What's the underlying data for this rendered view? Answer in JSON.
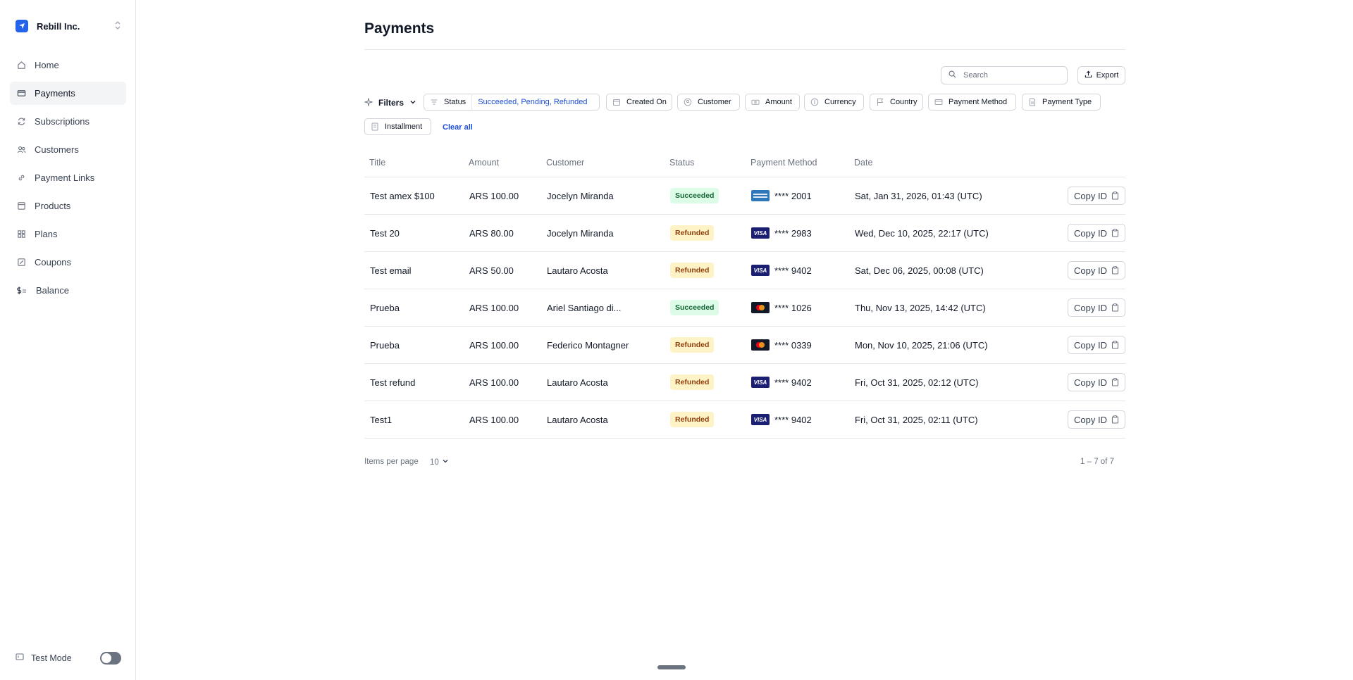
{
  "org": {
    "name": "Rebill Inc."
  },
  "sidebar": {
    "items": [
      {
        "label": "Home",
        "icon": "home-icon"
      },
      {
        "label": "Payments",
        "icon": "card-icon",
        "active": true
      },
      {
        "label": "Subscriptions",
        "icon": "refresh-icon"
      },
      {
        "label": "Customers",
        "icon": "users-icon"
      },
      {
        "label": "Payment Links",
        "icon": "link-icon"
      },
      {
        "label": "Products",
        "icon": "box-icon"
      },
      {
        "label": "Plans",
        "icon": "grid-icon"
      },
      {
        "label": "Coupons",
        "icon": "coupon-icon"
      },
      {
        "label": "Balance",
        "icon": "dollar-icon"
      }
    ],
    "test_mode_label": "Test Mode",
    "test_mode_on": false
  },
  "page": {
    "title": "Payments"
  },
  "toolbar": {
    "search_placeholder": "Search",
    "export_label": "Export"
  },
  "filters": {
    "label": "Filters",
    "status_label": "Status",
    "status_value": "Succeeded, Pending, Refunded",
    "chips": [
      "Created On",
      "Customer",
      "Amount",
      "Currency",
      "Country",
      "Payment Method",
      "Payment Type",
      "Installment"
    ],
    "clear_all": "Clear all"
  },
  "table": {
    "columns": [
      "Title",
      "Amount",
      "Customer",
      "Status",
      "Payment Method",
      "Date",
      ""
    ],
    "copy_label": "Copy ID",
    "rows": [
      {
        "title": "Test amex $100",
        "amount": "ARS 100.00",
        "customer": "Jocelyn Miranda",
        "status": "Succeeded",
        "card_brand": "amex",
        "card_last4": "**** 2001",
        "date": "Sat, Jan 31, 2026, 01:43 (UTC)"
      },
      {
        "title": "Test 20",
        "amount": "ARS 80.00",
        "customer": "Jocelyn Miranda",
        "status": "Refunded",
        "card_brand": "visa",
        "card_last4": "**** 2983",
        "date": "Wed, Dec 10, 2025, 22:17 (UTC)"
      },
      {
        "title": "Test email",
        "amount": "ARS 50.00",
        "customer": "Lautaro Acosta",
        "status": "Refunded",
        "card_brand": "visa",
        "card_last4": "**** 9402",
        "date": "Sat, Dec 06, 2025, 00:08 (UTC)"
      },
      {
        "title": "Prueba",
        "amount": "ARS 100.00",
        "customer": "Ariel Santiago di...",
        "status": "Succeeded",
        "card_brand": "mastercard",
        "card_last4": "**** 1026",
        "date": "Thu, Nov 13, 2025, 14:42 (UTC)"
      },
      {
        "title": "Prueba",
        "amount": "ARS 100.00",
        "customer": "Federico Montagner",
        "status": "Refunded",
        "card_brand": "mastercard",
        "card_last4": "**** 0339",
        "date": "Mon, Nov 10, 2025, 21:06 (UTC)"
      },
      {
        "title": "Test refund",
        "amount": "ARS 100.00",
        "customer": "Lautaro Acosta",
        "status": "Refunded",
        "card_brand": "visa",
        "card_last4": "**** 9402",
        "date": "Fri, Oct 31, 2025, 02:12 (UTC)"
      },
      {
        "title": "Test1",
        "amount": "ARS 100.00",
        "customer": "Lautaro Acosta",
        "status": "Refunded",
        "card_brand": "visa",
        "card_last4": "**** 9402",
        "date": "Fri, Oct 31, 2025, 02:11 (UTC)"
      }
    ]
  },
  "pagination": {
    "items_per_page_label": "Items per page",
    "items_per_page": "10",
    "range": "1 – 7 of 7"
  },
  "visa_text": "VISA",
  "colors": {
    "accent": "#1d4ed8",
    "brand": "#2563eb",
    "succeeded_bg": "#dcfce7",
    "succeeded_fg": "#166534",
    "refunded_bg": "#fef3c7",
    "refunded_fg": "#92400e"
  }
}
